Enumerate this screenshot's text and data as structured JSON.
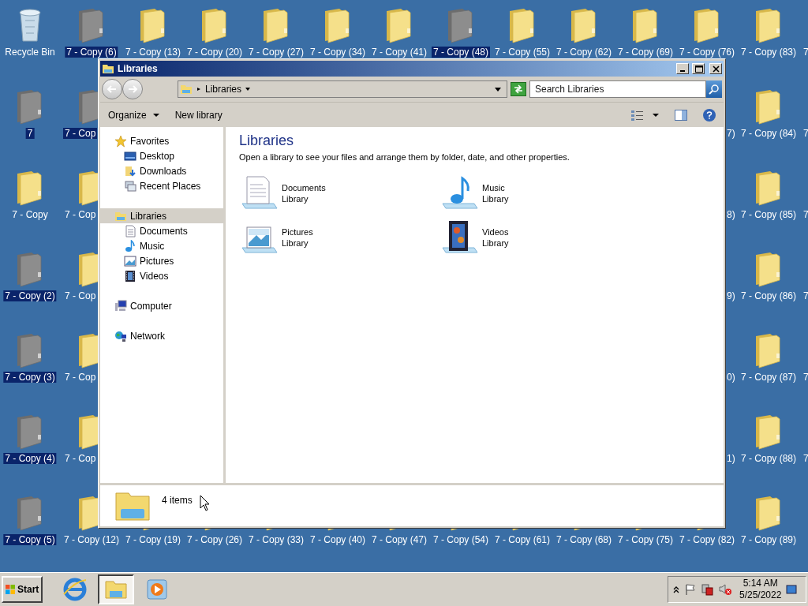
{
  "desktop_rows": [
    {
      "left": [
        {
          "label": "Recycle Bin",
          "kind": "recycle",
          "selected": false
        },
        {
          "label": "7 - Copy (6)",
          "kind": "folder",
          "selected": true
        },
        {
          "label": "7 - Copy (13)",
          "kind": "folder",
          "selected": false
        },
        {
          "label": "7 - Copy (20)",
          "kind": "folder",
          "selected": false
        },
        {
          "label": "7 - Copy (27)",
          "kind": "folder",
          "selected": false
        },
        {
          "label": "7 - Copy (34)",
          "kind": "folder",
          "selected": false
        },
        {
          "label": "7 - Copy (41)",
          "kind": "folder",
          "selected": false
        },
        {
          "label": "7 - Copy (48)",
          "kind": "folder",
          "selected": true
        },
        {
          "label": "7 - Copy (55)",
          "kind": "folder",
          "selected": false
        },
        {
          "label": "7 - Copy (62)",
          "kind": "folder",
          "selected": false
        },
        {
          "label": "7 - Copy (69)",
          "kind": "folder",
          "selected": false
        },
        {
          "label": "7 - Copy (76)",
          "kind": "folder",
          "selected": false
        },
        {
          "label": "7 - Copy (83)",
          "kind": "folder",
          "selected": false
        },
        {
          "label": "7",
          "kind": "cut_right",
          "selected": false
        }
      ]
    },
    {
      "left": [
        {
          "label": "7",
          "kind": "folder",
          "selected": true
        },
        {
          "label": "7 - Cop",
          "kind": "cut_right",
          "selected": true
        }
      ],
      "right": [
        {
          "label": "7)",
          "kind": "cut_left",
          "selected": false
        },
        {
          "label": "7 - Copy (84)",
          "kind": "folder",
          "selected": false
        },
        {
          "label": "7",
          "kind": "cut_right",
          "selected": false
        }
      ]
    },
    {
      "left": [
        {
          "label": "7 - Copy",
          "kind": "folder",
          "selected": false
        },
        {
          "label": "7 - Cop",
          "kind": "cut_right",
          "selected": false
        }
      ],
      "right": [
        {
          "label": "8)",
          "kind": "cut_left",
          "selected": false
        },
        {
          "label": "7 - Copy (85)",
          "kind": "folder",
          "selected": false
        },
        {
          "label": "7",
          "kind": "cut_right",
          "selected": false
        }
      ]
    },
    {
      "left": [
        {
          "label": "7 - Copy (2)",
          "kind": "folder",
          "selected": true
        },
        {
          "label": "7 - Cop",
          "kind": "cut_right",
          "selected": false
        }
      ],
      "right": [
        {
          "label": "9)",
          "kind": "cut_left",
          "selected": false
        },
        {
          "label": "7 - Copy (86)",
          "kind": "folder",
          "selected": false
        },
        {
          "label": "7",
          "kind": "cut_right",
          "selected": false
        }
      ]
    },
    {
      "left": [
        {
          "label": "7 - Copy (3)",
          "kind": "folder",
          "selected": true
        },
        {
          "label": "7 - Cop",
          "kind": "cut_right",
          "selected": false
        }
      ],
      "right": [
        {
          "label": "0)",
          "kind": "cut_left",
          "selected": false
        },
        {
          "label": "7 - Copy (87)",
          "kind": "folder",
          "selected": false
        },
        {
          "label": "7",
          "kind": "cut_right",
          "selected": false
        }
      ]
    },
    {
      "left": [
        {
          "label": "7 - Copy (4)",
          "kind": "folder",
          "selected": true
        },
        {
          "label": "7 - Cop",
          "kind": "cut_right",
          "selected": false
        }
      ],
      "right": [
        {
          "label": "1)",
          "kind": "cut_left",
          "selected": false
        },
        {
          "label": "7 - Copy (88)",
          "kind": "folder",
          "selected": false
        },
        {
          "label": "7",
          "kind": "cut_right",
          "selected": false
        }
      ]
    },
    {
      "left": [
        {
          "label": "7 - Copy (5)",
          "kind": "folder",
          "selected": true
        },
        {
          "label": "7 - Copy (12)",
          "kind": "folder",
          "selected": false
        },
        {
          "label": "7 - Copy (19)",
          "kind": "folder",
          "selected": false
        },
        {
          "label": "7 - Copy (26)",
          "kind": "folder",
          "selected": false
        },
        {
          "label": "7 - Copy (33)",
          "kind": "folder",
          "selected": false
        },
        {
          "label": "7 - Copy (40)",
          "kind": "folder",
          "selected": false
        },
        {
          "label": "7 - Copy (47)",
          "kind": "folder",
          "selected": false
        },
        {
          "label": "7 - Copy (54)",
          "kind": "folder",
          "selected": false
        },
        {
          "label": "7 - Copy (61)",
          "kind": "folder",
          "selected": false
        },
        {
          "label": "7 - Copy (68)",
          "kind": "folder",
          "selected": false
        },
        {
          "label": "7 - Copy (75)",
          "kind": "folder",
          "selected": false
        },
        {
          "label": "7 - Copy (82)",
          "kind": "folder",
          "selected": false
        },
        {
          "label": "7 - Copy (89)",
          "kind": "folder",
          "selected": false
        }
      ]
    }
  ],
  "window": {
    "title": "Libraries",
    "address": {
      "crumb": "Libraries"
    },
    "search": {
      "placeholder": "Search Libraries"
    },
    "toolbar": {
      "organize": "Organize",
      "new_library": "New library"
    },
    "navigation": [
      {
        "label": "Favorites",
        "selected": false,
        "children": [
          {
            "label": "Desktop",
            "selected": false
          },
          {
            "label": "Downloads",
            "selected": false
          },
          {
            "label": "Recent Places",
            "selected": false
          }
        ]
      },
      {
        "label": "Libraries",
        "selected": true,
        "children": [
          {
            "label": "Documents",
            "selected": false
          },
          {
            "label": "Music",
            "selected": false
          },
          {
            "label": "Pictures",
            "selected": false
          },
          {
            "label": "Videos",
            "selected": false
          }
        ]
      },
      {
        "label": "Computer",
        "selected": false
      },
      {
        "label": "Network",
        "selected": false
      }
    ],
    "heading": "Libraries",
    "description": "Open a library to see your files and arrange them by folder, date, and other properties.",
    "libraries": [
      {
        "name": "Documents",
        "subtitle": "Library"
      },
      {
        "name": "Music",
        "subtitle": "Library"
      },
      {
        "name": "Pictures",
        "subtitle": "Library"
      },
      {
        "name": "Videos",
        "subtitle": "Library"
      }
    ],
    "details": {
      "count": "4 items"
    }
  },
  "taskbar": {
    "start": "Start",
    "apps": [
      {
        "selected": false
      },
      {
        "selected": true
      },
      {
        "selected": false
      }
    ],
    "time": "5:14 AM",
    "date": "5/25/2022"
  }
}
